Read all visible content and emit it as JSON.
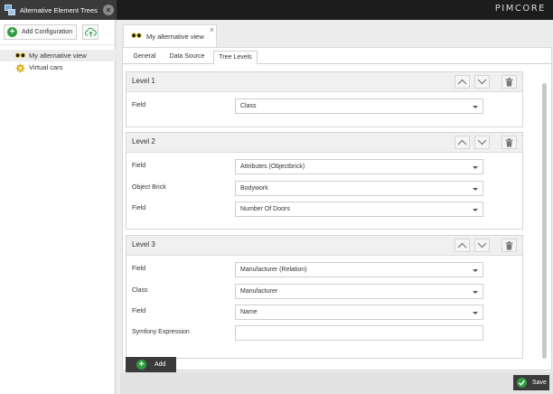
{
  "top_bar": {
    "tab_title": "Alternative Element Trees",
    "tab_close": "×",
    "brand": "PIMCORE"
  },
  "left_panel": {
    "add_button_label": "Add Configuration",
    "tree": [
      {
        "label": "My alternative view",
        "icon": "glasses-icon",
        "selected": true
      },
      {
        "label": "Virtual cars",
        "icon": "gear-icon",
        "selected": false
      }
    ]
  },
  "doc_tab": {
    "title": "My alternative view",
    "close": "×"
  },
  "subtabs": [
    "General",
    "Data Source",
    "Tree Levels"
  ],
  "active_subtab": "Tree Levels",
  "levels": [
    {
      "title": "Level 1",
      "fields": [
        {
          "label": "Field",
          "value": "Class",
          "type": "select"
        }
      ]
    },
    {
      "title": "Level 2",
      "fields": [
        {
          "label": "Field",
          "value": "Attributes (Objectbrick)",
          "type": "select"
        },
        {
          "label": "Object Brick",
          "value": "Bodywork",
          "type": "select"
        },
        {
          "label": "Field",
          "value": "Number Of Doors",
          "type": "select"
        }
      ]
    },
    {
      "title": "Level 3",
      "fields": [
        {
          "label": "Field",
          "value": "Manufacturer (Relation)",
          "type": "select"
        },
        {
          "label": "Class",
          "value": "Manufacturer",
          "type": "select"
        },
        {
          "label": "Field",
          "value": "Name",
          "type": "select"
        },
        {
          "label": "Symfony Expression",
          "value": "",
          "type": "input"
        }
      ]
    }
  ],
  "add_button": "Add",
  "save_button": "Save",
  "colors": {
    "accent_green": "#2e9e3e",
    "dark_bar": "#1c1c1c",
    "button_dark": "#3b3b3b"
  }
}
